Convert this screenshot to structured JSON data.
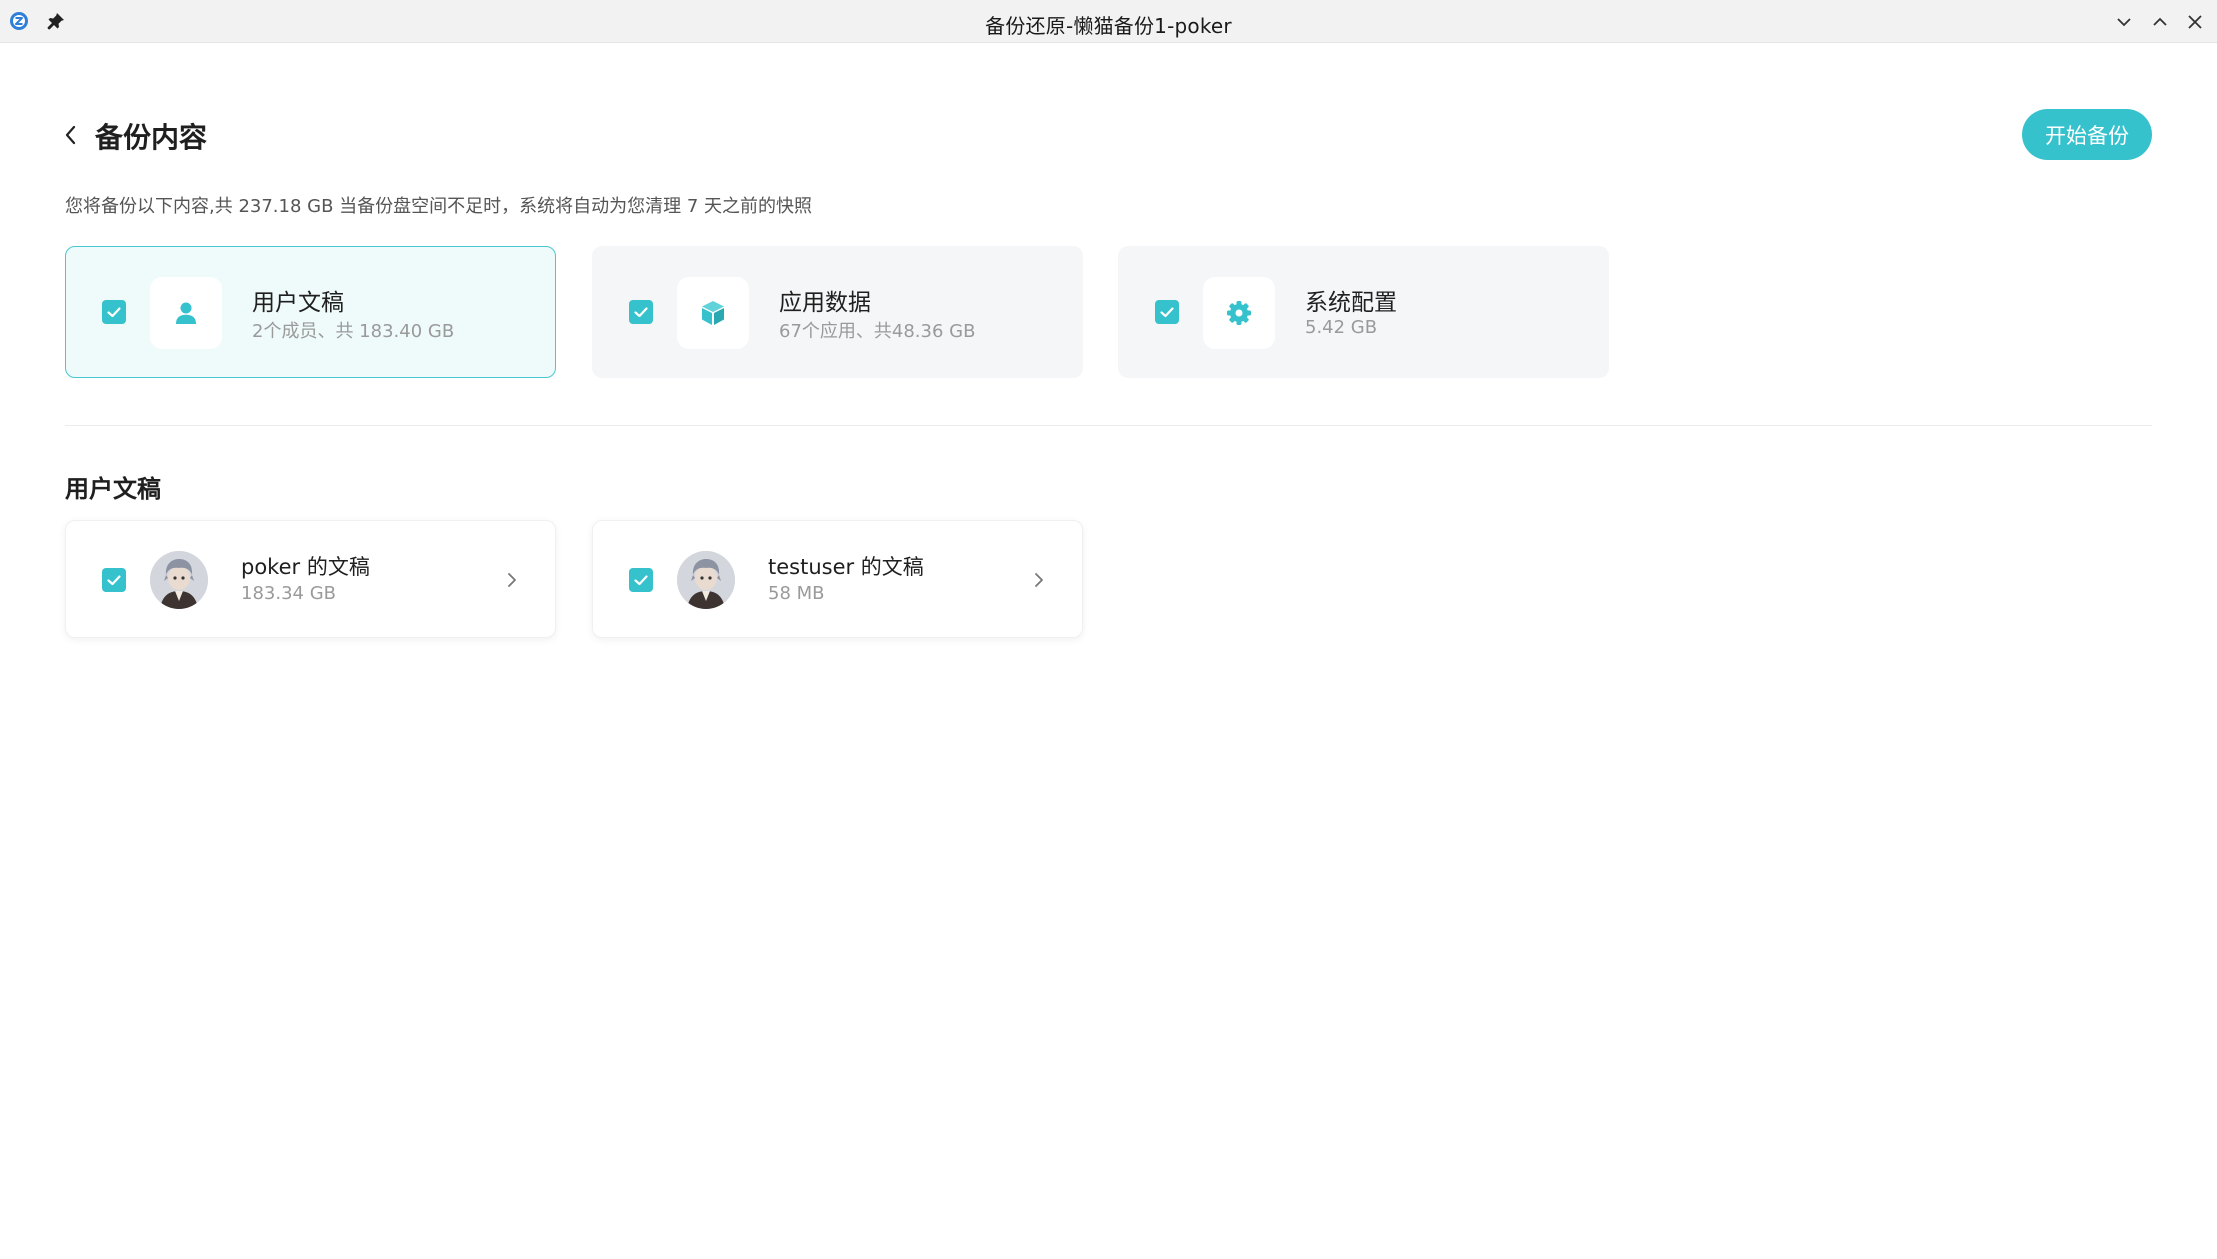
{
  "window": {
    "title": "备份还原-懒猫备份1-poker",
    "app_icon": "app-logo-icon",
    "pin_icon": "pin-icon",
    "controls": [
      "minimize-chevron-down-icon",
      "maximize-chevron-up-icon",
      "close-icon"
    ]
  },
  "header": {
    "title": "备份内容",
    "back_icon": "chevron-left-icon",
    "start_button": "开始备份",
    "description": "您将备份以下内容,共 237.18 GB 当备份盘空间不足时，系统将自动为您清理 7 天之前的快照"
  },
  "categories": [
    {
      "title": "用户文稿",
      "subtitle": "2个成员、共 183.40 GB",
      "icon": "user-icon",
      "checked": true,
      "selected": true
    },
    {
      "title": "应用数据",
      "subtitle": "67个应用、共48.36 GB",
      "icon": "cube-icon",
      "checked": true,
      "selected": false
    },
    {
      "title": "系统配置",
      "subtitle": "5.42 GB",
      "icon": "gear-icon",
      "checked": true,
      "selected": false
    }
  ],
  "section": {
    "title": "用户文稿"
  },
  "users": [
    {
      "name": "poker 的文稿",
      "size": "183.34 GB",
      "checked": true,
      "avatar": "avatar-image"
    },
    {
      "name": "testuser 的文稿",
      "size": "58 MB",
      "checked": true,
      "avatar": "avatar-image"
    }
  ],
  "colors": {
    "accent": "#36c2cc",
    "selected_card_bg": "#effafb",
    "selected_card_border": "#49c7d1",
    "card_bg": "#f5f6f7",
    "titlebar_bg": "#f2f2f2"
  }
}
